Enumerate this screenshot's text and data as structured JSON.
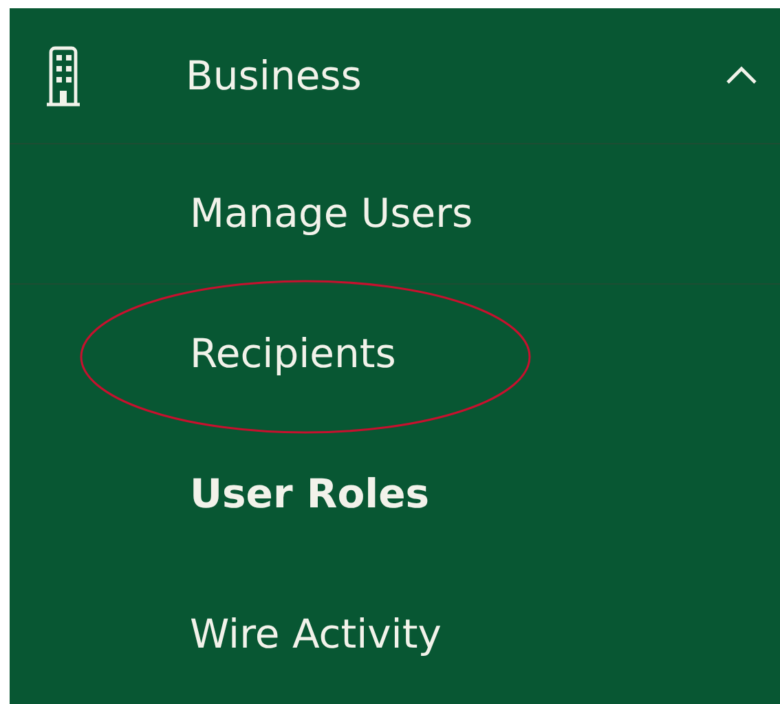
{
  "section": {
    "title": "Business",
    "expanded": true
  },
  "items": [
    {
      "label": "Manage Users",
      "selected": false,
      "circled": false,
      "separator": true
    },
    {
      "label": "Recipients",
      "selected": false,
      "circled": true,
      "separator": false
    },
    {
      "label": "User Roles",
      "selected": true,
      "circled": false,
      "separator": false
    },
    {
      "label": "Wire Activity",
      "selected": false,
      "circled": false,
      "separator": false
    }
  ]
}
